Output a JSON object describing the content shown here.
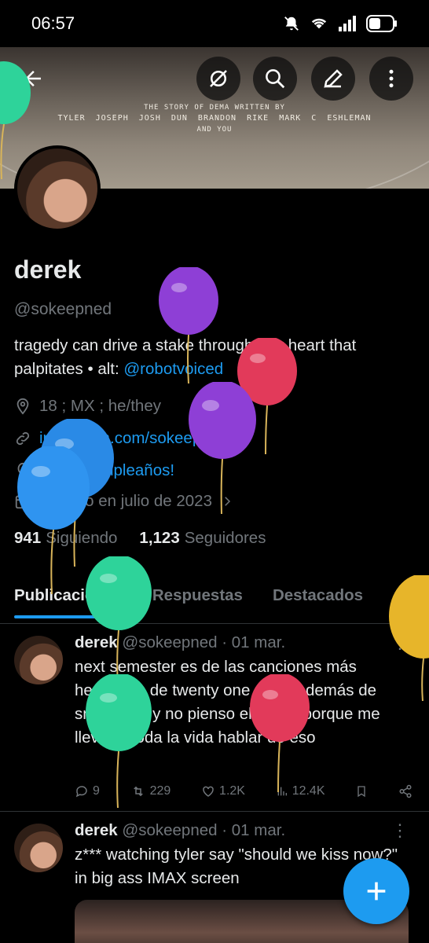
{
  "status_bar": {
    "time": "06:57"
  },
  "banner": {
    "line1": "THE STORY OF DEMA WRITTEN BY",
    "credits": "TYLER JOSEPH   JOSH DUN   BRANDON RIKE   MARK C ESHLEMAN",
    "line3": "AND YOU"
  },
  "profile": {
    "name": "derek",
    "handle": "@sokeepned",
    "bio_text": "tragedy can drive a stake through any heart that palpitates • alt: ",
    "bio_link": "@robotvoiced",
    "location": "18 ; MX ; he/they",
    "website": "instagram.com/sokeepned",
    "birthday": "¡Feliz cumpleaños!",
    "joined": "Se unió en julio de 2023",
    "following_count": "941",
    "following_label": "Siguiendo",
    "followers_count": "1,123",
    "followers_label": "Seguidores"
  },
  "tabs": [
    {
      "label": "Publicaciones"
    },
    {
      "label": "Respuestas"
    },
    {
      "label": "Destacados"
    }
  ],
  "tweets": [
    {
      "name": "derek",
      "handle": "@sokeepned",
      "date": "· 01 mar.",
      "text": "next semester es de las canciones más hermosas de twenty one pilots además de snap back y no pienso elaborar porque me llevaría toda la vida hablar de eso",
      "replies": "9",
      "reposts": "229",
      "likes": "1.2K",
      "views": "12.4K"
    },
    {
      "name": "derek",
      "handle": "@sokeepned",
      "date": "· 01 mar.",
      "text": "z*** watching tyler say \"should we kiss now?\" in big ass IMAX screen"
    }
  ],
  "colors": {
    "accent": "#1d9bf0",
    "muted": "#71767b",
    "text": "#e7e9ea"
  }
}
